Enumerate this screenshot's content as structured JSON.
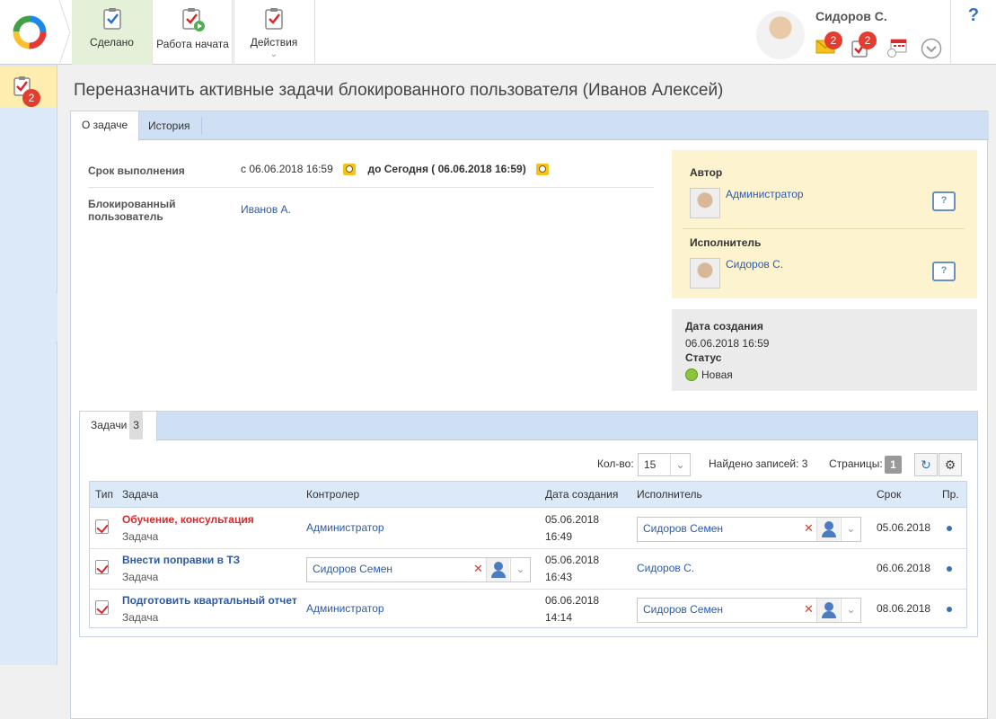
{
  "toolbar": {
    "done_label": "Сделано",
    "start_label": "Работа начата",
    "actions_label": "Действия"
  },
  "user": {
    "name": "Сидоров С.",
    "mail_count": "2",
    "tasks_count": "2"
  },
  "help_label": "?",
  "sidebar": {
    "tasks_badge": "2"
  },
  "page": {
    "title": "Переназначить активные задачи блокированного пользователя (Иванов Алексей)"
  },
  "tabs": [
    {
      "label": "О задаче"
    },
    {
      "label": "История"
    }
  ],
  "details": {
    "deadline_label": "Срок выполнения",
    "deadline_from": "с 06.06.2018 16:59",
    "deadline_to": "до Сегодня ( 06.06.2018 16:59)",
    "blocked_user_label": "Блокированный пользователь",
    "blocked_user_value": "Иванов А."
  },
  "author": {
    "author_label": "Автор",
    "author_name": "Администратор",
    "executor_label": "Исполнитель",
    "executor_name": "Сидоров С."
  },
  "info": {
    "created_label": "Дата создания",
    "created_value": "06.06.2018 16:59",
    "status_label": "Статус",
    "status_value": "Новая"
  },
  "tasks_tab": {
    "label": "Задачи",
    "count": "3"
  },
  "pager": {
    "qty_label": "Кол-во:",
    "qty_value": "15",
    "found_label": "Найдено записей:",
    "found_value": "3",
    "pages_label": "Страницы:",
    "page_num": "1"
  },
  "grid": {
    "headers": {
      "type": "Тип",
      "task": "Задача",
      "controller": "Контролер",
      "created": "Дата создания",
      "executor": "Исполнитель",
      "due": "Срок",
      "priority": "Пр."
    },
    "rows": [
      {
        "title": "Обучение, консультация",
        "kind": "Задача",
        "controller": "Администратор",
        "created_date": "05.06.2018",
        "created_time": "16:49",
        "executor": "Сидоров Семен",
        "due": "05.06.2018"
      },
      {
        "title": "Внести поправки в ТЗ",
        "kind": "Задача",
        "controller": "Сидоров Семен",
        "created_date": "05.06.2018",
        "created_time": "16:43",
        "executor": "Сидоров С.",
        "due": "06.06.2018"
      },
      {
        "title": "Подготовить квартальный отчет",
        "kind": "Задача",
        "controller": "Администратор",
        "created_date": "06.06.2018",
        "created_time": "14:14",
        "executor": "Сидоров Семен",
        "due": "08.06.2018"
      }
    ]
  }
}
